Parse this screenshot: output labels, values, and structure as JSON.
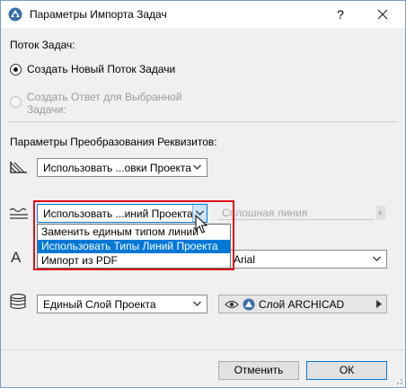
{
  "window": {
    "title": "Параметры Импорта Задач",
    "help_glyph": "?",
    "close_glyph": "✕"
  },
  "task_stream": {
    "heading": "Поток Задач:",
    "option_new": "Создать Новый Поток Задачи",
    "option_reply_line1": "Создать Ответ для Выбранной",
    "option_reply_line2": "Задачи:",
    "selected": "option_new"
  },
  "conversion": {
    "heading": "Параметры Преобразования Реквизитов:",
    "fill": {
      "icon": "fill-pattern-icon",
      "value": "Использовать ...овки Проекта"
    },
    "line": {
      "icon": "line-type-icon",
      "value": "Использовать ...иний Проекта",
      "line_type_label": "Сплошная линия",
      "dropdown_options": [
        "Заменить единым типом линий",
        "Использовать Типы Линий Проекта",
        "Импорт из PDF"
      ],
      "highlighted_option": "Использовать Типы Линий Проекта"
    },
    "font": {
      "icon": "font-a-icon",
      "glyph": "A",
      "value": "Arial"
    },
    "layer": {
      "icon": "layers-icon",
      "value": "Единый Слой Проекта",
      "layer_name": "Слой ARCHICAD"
    }
  },
  "buttons": {
    "cancel": "Отменить",
    "ok": "ОК"
  },
  "colors": {
    "highlight": "#0078d7",
    "annotation_red": "#e0101a",
    "disabled_text": "#9a9a9a"
  }
}
